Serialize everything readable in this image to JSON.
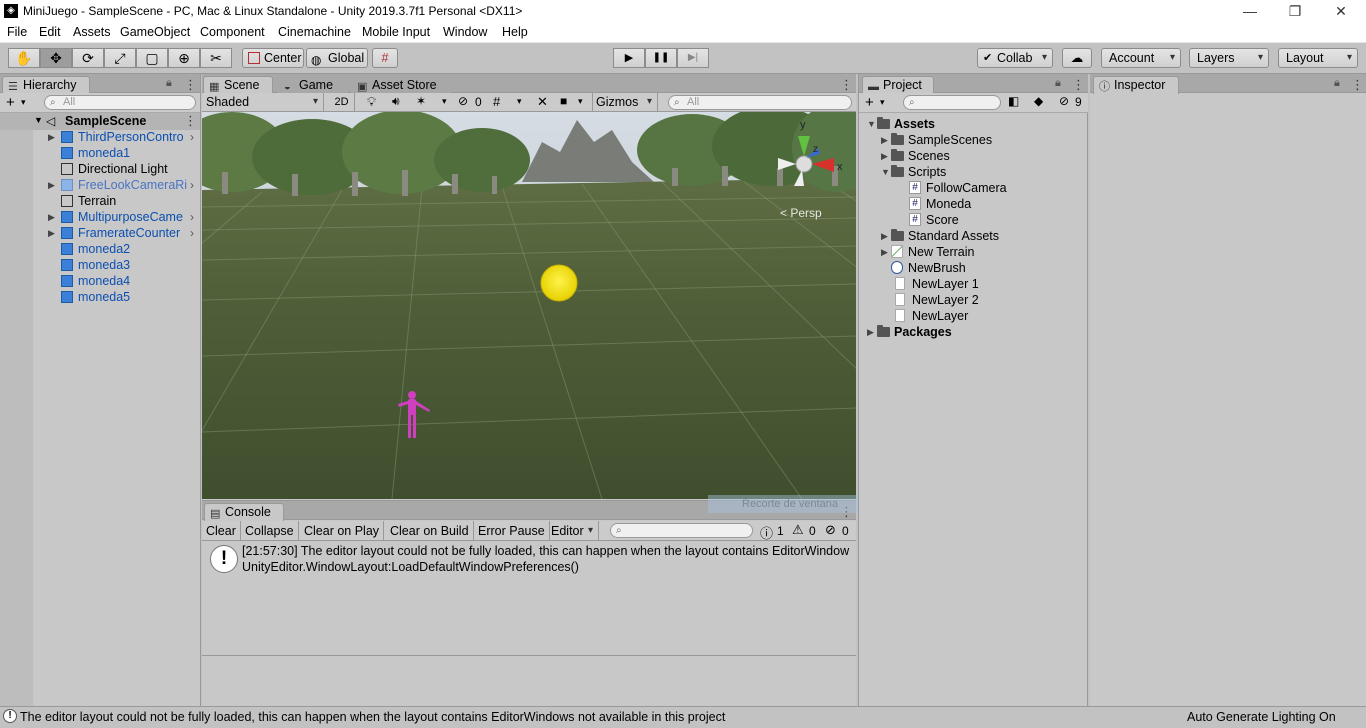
{
  "window": {
    "title": "MiniJuego - SampleScene - PC, Mac & Linux Standalone - Unity 2019.3.7f1 Personal <DX11>",
    "logo_glyph": "◈",
    "minimize_glyph": "—",
    "maximize_glyph": "❐",
    "close_glyph": "✕"
  },
  "menu": [
    "File",
    "Edit",
    "Assets",
    "GameObject",
    "Component",
    "Cinemachine",
    "Mobile Input",
    "Window",
    "Help"
  ],
  "toolbar": {
    "tools": [
      "✋",
      "✥",
      "⟳",
      "⤢",
      "▢",
      "⊕",
      "✂"
    ],
    "center_label": "Center",
    "global_label": "Global",
    "play_glyph": "▶",
    "pause_glyph": "❚❚",
    "step_glyph": "▶|",
    "collab_label": "Collab",
    "account_label": "Account",
    "layers_label": "Layers",
    "layout_label": "Layout"
  },
  "hierarchy": {
    "tab_label": "Hierarchy",
    "search_placeholder": "All",
    "scene_name": "SampleScene",
    "items": [
      {
        "label": "ThirdPersonContro",
        "style": "blue",
        "expand": true,
        "chevron": true,
        "icon": "cube"
      },
      {
        "label": "moneda1",
        "style": "blue",
        "expand": false,
        "chevron": false,
        "icon": "cube"
      },
      {
        "label": "Directional Light",
        "style": "plain",
        "expand": false,
        "chevron": false,
        "icon": "outline"
      },
      {
        "label": "FreeLookCameraRi",
        "style": "pblue",
        "expand": true,
        "chevron": true,
        "icon": "cube-light"
      },
      {
        "label": "Terrain",
        "style": "plain",
        "expand": false,
        "chevron": false,
        "icon": "outline"
      },
      {
        "label": "MultipurposeCame",
        "style": "blue",
        "expand": true,
        "chevron": true,
        "icon": "cube"
      },
      {
        "label": "FramerateCounter",
        "style": "blue",
        "expand": true,
        "chevron": true,
        "icon": "cube"
      },
      {
        "label": "moneda2",
        "style": "blue",
        "expand": false,
        "chevron": false,
        "icon": "cube"
      },
      {
        "label": "moneda3",
        "style": "blue",
        "expand": false,
        "chevron": false,
        "icon": "cube"
      },
      {
        "label": "moneda4",
        "style": "blue",
        "expand": false,
        "chevron": false,
        "icon": "cube"
      },
      {
        "label": "moneda5",
        "style": "blue",
        "expand": false,
        "chevron": false,
        "icon": "cube"
      }
    ]
  },
  "scene": {
    "tabs": [
      "Scene",
      "Game",
      "Asset Store"
    ],
    "shading_mode": "Shaded",
    "mode_2d": "2D",
    "hidden_count": "0",
    "gizmos_label": "Gizmos",
    "search_placeholder": "All",
    "persp_label": "< Persp",
    "axis_x": "x",
    "axis_y": "y",
    "axis_z": "z"
  },
  "console": {
    "tab_label": "Console",
    "buttons": [
      "Clear",
      "Collapse",
      "Clear on Play",
      "Clear on Build",
      "Error Pause",
      "Editor"
    ],
    "count_log": "1",
    "count_warn": "0",
    "count_error": "0",
    "message_line1": "[21:57:30] The editor layout could not be fully loaded, this can happen when the layout contains EditorWindow",
    "message_line2": "UnityEditor.WindowLayout:LoadDefaultWindowPreferences()"
  },
  "project": {
    "tab_label": "Project",
    "hidden_count": "9",
    "items": [
      {
        "label": "Assets",
        "indent": 0,
        "type": "folder",
        "arrow": "▼",
        "bold": true
      },
      {
        "label": "SampleScenes",
        "indent": 1,
        "type": "folder",
        "arrow": "▶",
        "bold": false
      },
      {
        "label": "Scenes",
        "indent": 1,
        "type": "folder",
        "arrow": "▶",
        "bold": false
      },
      {
        "label": "Scripts",
        "indent": 1,
        "type": "folder",
        "arrow": "▼",
        "bold": false
      },
      {
        "label": "FollowCamera",
        "indent": 2,
        "type": "script",
        "arrow": "",
        "bold": false
      },
      {
        "label": "Moneda",
        "indent": 2,
        "type": "script",
        "arrow": "",
        "bold": false
      },
      {
        "label": "Score",
        "indent": 2,
        "type": "script",
        "arrow": "",
        "bold": false
      },
      {
        "label": "Standard Assets",
        "indent": 1,
        "type": "folder",
        "arrow": "▶",
        "bold": false
      },
      {
        "label": "New Terrain",
        "indent": 1,
        "type": "terrain",
        "arrow": "▶",
        "bold": false
      },
      {
        "label": "NewBrush",
        "indent": 1,
        "type": "brush",
        "arrow": "",
        "bold": false
      },
      {
        "label": "NewLayer 1",
        "indent": 1,
        "type": "doc",
        "arrow": "",
        "bold": false
      },
      {
        "label": "NewLayer 2",
        "indent": 1,
        "type": "doc",
        "arrow": "",
        "bold": false
      },
      {
        "label": "NewLayer",
        "indent": 1,
        "type": "doc",
        "arrow": "",
        "bold": false
      },
      {
        "label": "Packages",
        "indent": 0,
        "type": "folder",
        "arrow": "▶",
        "bold": true
      }
    ]
  },
  "inspector": {
    "tab_label": "Inspector"
  },
  "status": {
    "message": "The editor layout could not be fully loaded, this can happen when the layout contains EditorWindows not available in this project",
    "right_text": "Auto Generate Lighting On"
  },
  "overlay_text": "Recorte de ventana"
}
